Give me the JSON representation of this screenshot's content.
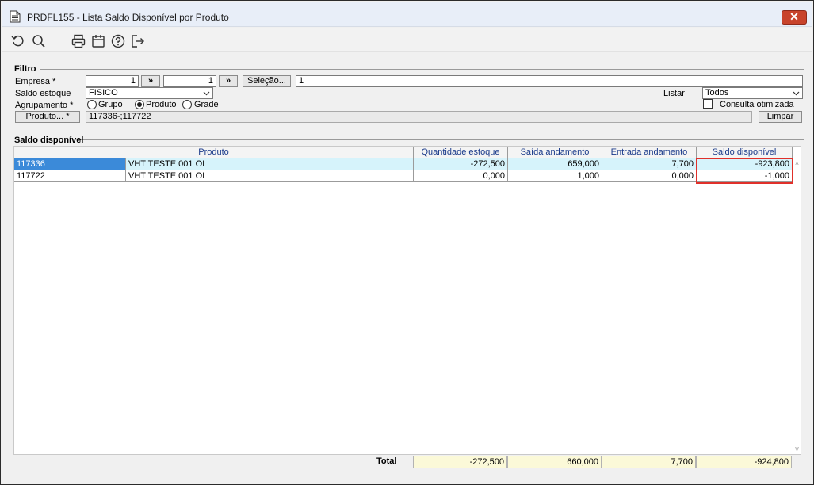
{
  "window": {
    "title": "PRDFL155 - Lista Saldo Disponível por Produto",
    "close_label": "✕"
  },
  "toolbar": {
    "icons": [
      "refresh-icon",
      "search-icon",
      "print-icon",
      "calendar-icon",
      "help-icon",
      "exit-icon"
    ]
  },
  "filter": {
    "legend": "Filtro",
    "empresa_label": "Empresa *",
    "empresa_from": "1",
    "empresa_to": "1",
    "lookup_button": "»",
    "selecao_button": "Seleção...",
    "selecao_value": "1",
    "saldo_label": "Saldo estoque",
    "saldo_value": "FISICO",
    "listar_label": "Listar",
    "listar_value": "Todos",
    "agrupamento_label": "Agrupamento *",
    "agrupamento_options": [
      "Grupo",
      "Produto",
      "Grade"
    ],
    "agrupamento_selected": "Produto",
    "consulta_label": "Consulta otimizada",
    "produto_button": "Produto... *",
    "produto_value": "117336-;117722",
    "limpar_button": "Limpar"
  },
  "saldo": {
    "legend": "Saldo disponível",
    "columns": [
      "Produto",
      "Quantidade estoque",
      "Saída andamento",
      "Entrada andamento",
      "Saldo disponível"
    ],
    "rows": [
      {
        "code": "117336",
        "name": "VHT TESTE 001 OI",
        "qtd": "-272,500",
        "saida": "659,000",
        "entrada": "7,700",
        "saldo": "-923,800"
      },
      {
        "code": "117722",
        "name": "VHT TESTE 001 OI",
        "qtd": "0,000",
        "saida": "1,000",
        "entrada": "0,000",
        "saldo": "-1,000"
      }
    ],
    "total_label": "Total",
    "totals": {
      "qtd": "-272,500",
      "saida": "660,000",
      "entrada": "7,700",
      "saldo": "-924,800"
    }
  },
  "colors": {
    "highlight_border": "#e0302a",
    "selected_row": "#d6f3fb",
    "selected_cell": "#3b8ad9",
    "totals_bg": "#fbf9d8",
    "header_text": "#1a3a8a"
  }
}
